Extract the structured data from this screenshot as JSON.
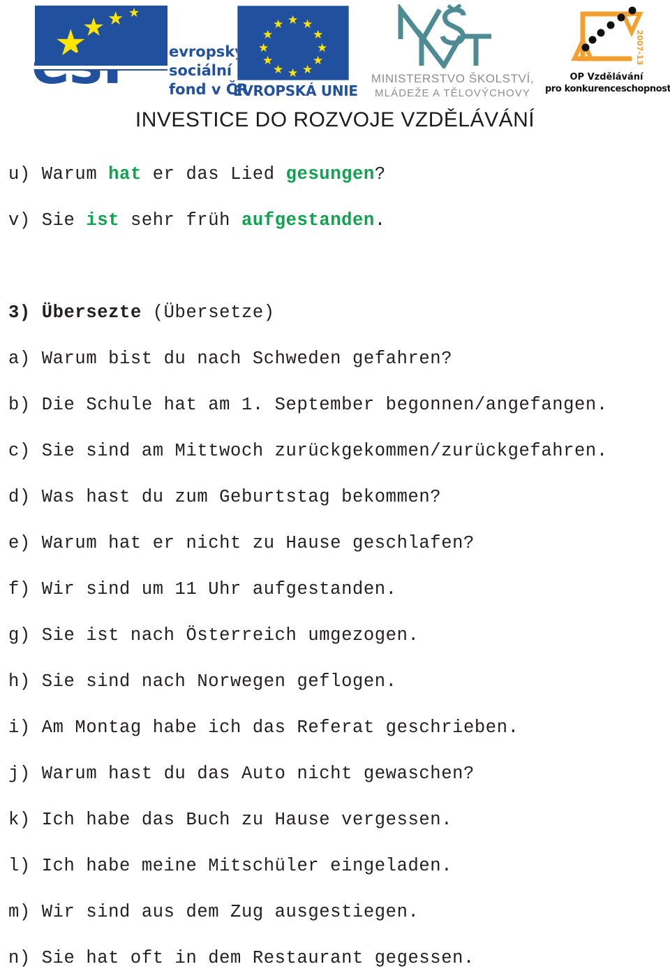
{
  "header": {
    "esf": {
      "name": "esf-logo",
      "wordmark": "esf",
      "line1": "evropský",
      "line2": "sociální",
      "line3": "fond v ČR"
    },
    "eu": {
      "name": "eu-flag-logo",
      "caption": "EVROPSKÁ UNIE"
    },
    "msmt": {
      "name": "msmt-logo",
      "caption_line1": "MINISTERSTVO ŠKOLSTVÍ,",
      "caption_line2": "MLÁDEŽE A TĚLOVÝCHOVY"
    },
    "opvk": {
      "name": "op-vzdelavani-logo",
      "caption_line1": "OP Vzdělávání",
      "caption_line2": "pro konkurenceschopnost",
      "years": "2007-13"
    },
    "slogan": "INVESTICE DO ROZVOJE VZDĚLÁVÁNÍ"
  },
  "colors": {
    "highlight_green": "#11a24f",
    "eu_blue": "#20509e",
    "msmt_teal": "#4d8c93",
    "opvk_orange": "#f2a030",
    "body_text": "#231f20"
  },
  "exercise_previous": {
    "items": [
      {
        "label": "u)",
        "parts": [
          {
            "text": "Warum ",
            "highlight": false
          },
          {
            "text": "hat",
            "highlight": true
          },
          {
            "text": " er das Lied ",
            "highlight": false
          },
          {
            "text": "gesungen",
            "highlight": true
          },
          {
            "text": "?",
            "highlight": false
          }
        ],
        "plain": "u) Warum hat er das Lied gesungen?"
      },
      {
        "label": "v)",
        "parts": [
          {
            "text": "Sie ",
            "highlight": false
          },
          {
            "text": "ist",
            "highlight": true
          },
          {
            "text": " sehr früh ",
            "highlight": false
          },
          {
            "text": "aufgestanden",
            "highlight": true
          },
          {
            "text": ".",
            "highlight": false
          }
        ],
        "plain": "v) Sie ist sehr früh aufgestanden."
      }
    ]
  },
  "exercise3": {
    "number": "3)",
    "title_bold": "Übersezte",
    "title_plain": "(Übersetze)",
    "items": [
      {
        "label": "a)",
        "text": "a) Warum bist du nach Schweden gefahren?"
      },
      {
        "label": "b)",
        "text": "b) Die Schule hat am 1. September begonnen/angefangen."
      },
      {
        "label": "c)",
        "text": "c) Sie sind am Mittwoch zurückgekommen/zurückgefahren."
      },
      {
        "label": "d)",
        "text": "d) Was hast du zum Geburtstag bekommen?"
      },
      {
        "label": "e)",
        "text": "e) Warum hat er nicht zu Hause geschlafen?"
      },
      {
        "label": "f)",
        "text": "f) Wir sind um 11 Uhr aufgestanden."
      },
      {
        "label": "g)",
        "text": "g) Sie ist nach Österreich umgezogen."
      },
      {
        "label": "h)",
        "text": "h) Sie sind nach Norwegen geflogen."
      },
      {
        "label": "i)",
        "text": "i) Am Montag habe ich das Referat geschrieben."
      },
      {
        "label": "j)",
        "text": "j) Warum hast du das Auto nicht gewaschen?"
      },
      {
        "label": "k)",
        "text": "k) Ich habe das Buch zu Hause vergessen."
      },
      {
        "label": "l)",
        "text": "l) Ich habe meine Mitschüler eingeladen."
      },
      {
        "label": "m)",
        "text": "m) Wir sind aus dem Zug ausgestiegen."
      },
      {
        "label": "n)",
        "text": "n) Sie hat oft in dem Restaurant gegessen."
      }
    ]
  }
}
